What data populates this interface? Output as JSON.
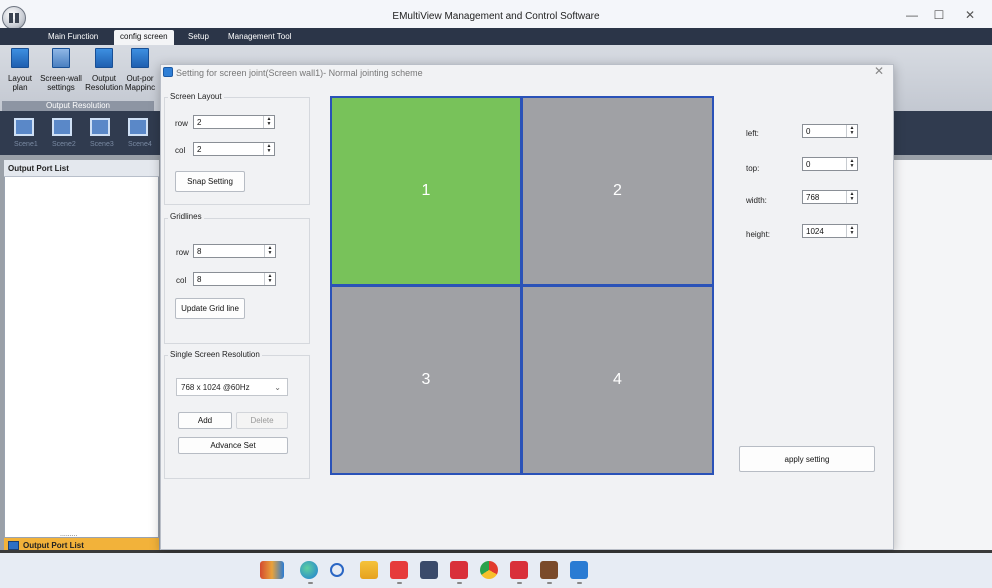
{
  "app": {
    "title": "EMultiView Management and Control Software"
  },
  "window_controls": {
    "minimize": "—",
    "maximize": "☐",
    "close": "✕"
  },
  "menu": {
    "tabs": [
      "Main Function",
      "config screen",
      "Setup",
      "Management Tool"
    ],
    "active": "config screen"
  },
  "ribbon": {
    "buttons": [
      {
        "line1": "Layout",
        "line2": "plan"
      },
      {
        "line1": "Screen-wall",
        "line2": "settings"
      },
      {
        "line1": "Output",
        "line2": "Resolution"
      },
      {
        "line1": "Out-por",
        "line2": "Mappinc"
      }
    ],
    "group_label": "Output Resolution"
  },
  "scenes": {
    "labels": [
      "Scene1",
      "Scene2",
      "Scene3",
      "Scene4"
    ]
  },
  "left_panel": {
    "header": "Output Port List",
    "footer": "Output Port List",
    "dots": "........."
  },
  "dialog": {
    "title": "Setting for screen joint(Screen wall1)- Normal jointing scheme",
    "close": "✕",
    "screen_layout": {
      "title": "Screen Layout",
      "row_label": "row",
      "row_value": "2",
      "col_label": "col",
      "col_value": "2",
      "snap_button": "Snap Setting"
    },
    "gridlines": {
      "title": "Gridlines",
      "row_label": "row",
      "row_value": "8",
      "col_label": "col",
      "col_value": "8",
      "update_button": "Update Grid line"
    },
    "resolution": {
      "title": "Single Screen Resolution",
      "selected": "768 x 1024 @60Hz",
      "add_button": "Add",
      "delete_button": "Delete",
      "advance_button": "Advance Set"
    },
    "preview": {
      "cells": [
        {
          "label": "1",
          "selected": true
        },
        {
          "label": "2",
          "selected": false
        },
        {
          "label": "3",
          "selected": false
        },
        {
          "label": "4",
          "selected": false
        }
      ]
    },
    "props": {
      "left_label": "left:",
      "left_value": "0",
      "top_label": "top:",
      "top_value": "0",
      "width_label": "width:",
      "width_value": "768",
      "height_label": "height:",
      "height_value": "1024",
      "apply_button": "apply setting"
    }
  },
  "colors": {
    "selected_cell": "#78c25a",
    "cell": "#a0a1a5",
    "cell_border": "#2a52b8",
    "accent": "#f2b23a"
  },
  "taskbar": {
    "icons": [
      "library-icon",
      "edge-icon",
      "search-icon",
      "file-explorer-icon",
      "calendar-app-icon",
      "calculator-icon",
      "wps-writer-icon",
      "chrome-icon",
      "wps-icon",
      "photos-icon",
      "emultiview-icon"
    ]
  }
}
